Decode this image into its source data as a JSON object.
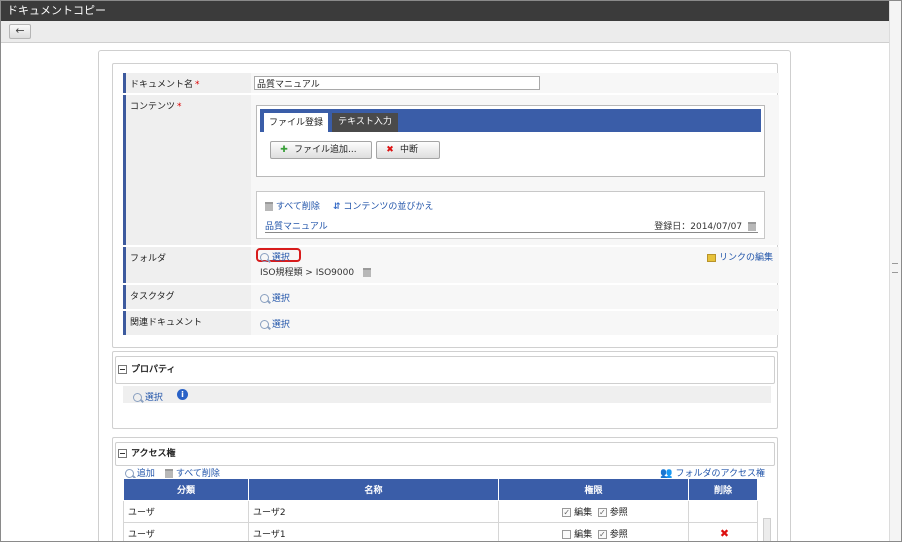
{
  "window": {
    "title": "ドキュメントコピー"
  },
  "toolbar": {
    "back_icon": "arrow-left-icon"
  },
  "form": {
    "document_name": {
      "label": "ドキュメント名",
      "required_mark": "*",
      "value": "品質マニュアル"
    },
    "contents": {
      "label": "コンテンツ",
      "required_mark": "*",
      "tabs": [
        {
          "label": "ファイル登録",
          "active": true
        },
        {
          "label": "テキスト入力",
          "active": false
        }
      ],
      "add_file_button": "ファイル追加...",
      "cancel_button": "中断",
      "delete_all": "すべて削除",
      "reorder": "コンテンツの並びかえ",
      "file": {
        "name": "品質マニュアル",
        "registered": "登録日：2014/07/07"
      }
    },
    "folder": {
      "label": "フォルダ",
      "select": "選択",
      "path": "ISO規程類 > ISO9000",
      "edit_link": "リンクの編集"
    },
    "task_tag": {
      "label": "タスクタグ",
      "select": "選択"
    },
    "related_documents": {
      "label": "関連ドキュメント",
      "select": "選択"
    }
  },
  "properties": {
    "title": "プロパティ",
    "select": "選択"
  },
  "access": {
    "title": "アクセス権",
    "add": "追加",
    "delete_all": "すべて削除",
    "folder_access": "フォルダのアクセス権",
    "columns": [
      "分類",
      "名称",
      "権限",
      "削除"
    ],
    "perm_edit": "編集",
    "perm_view": "参照",
    "rows": [
      {
        "type": "ユーザ",
        "name": "ユーザ2",
        "edit": true,
        "view": true,
        "deletable": false
      },
      {
        "type": "ユーザ",
        "name": "ユーザ1",
        "edit": false,
        "view": true,
        "deletable": true
      }
    ]
  },
  "colors": {
    "accent": "#3a5da8",
    "title_bar": "#3b3b3b",
    "highlight": "#d81c1c",
    "delete": "#dd1111"
  }
}
